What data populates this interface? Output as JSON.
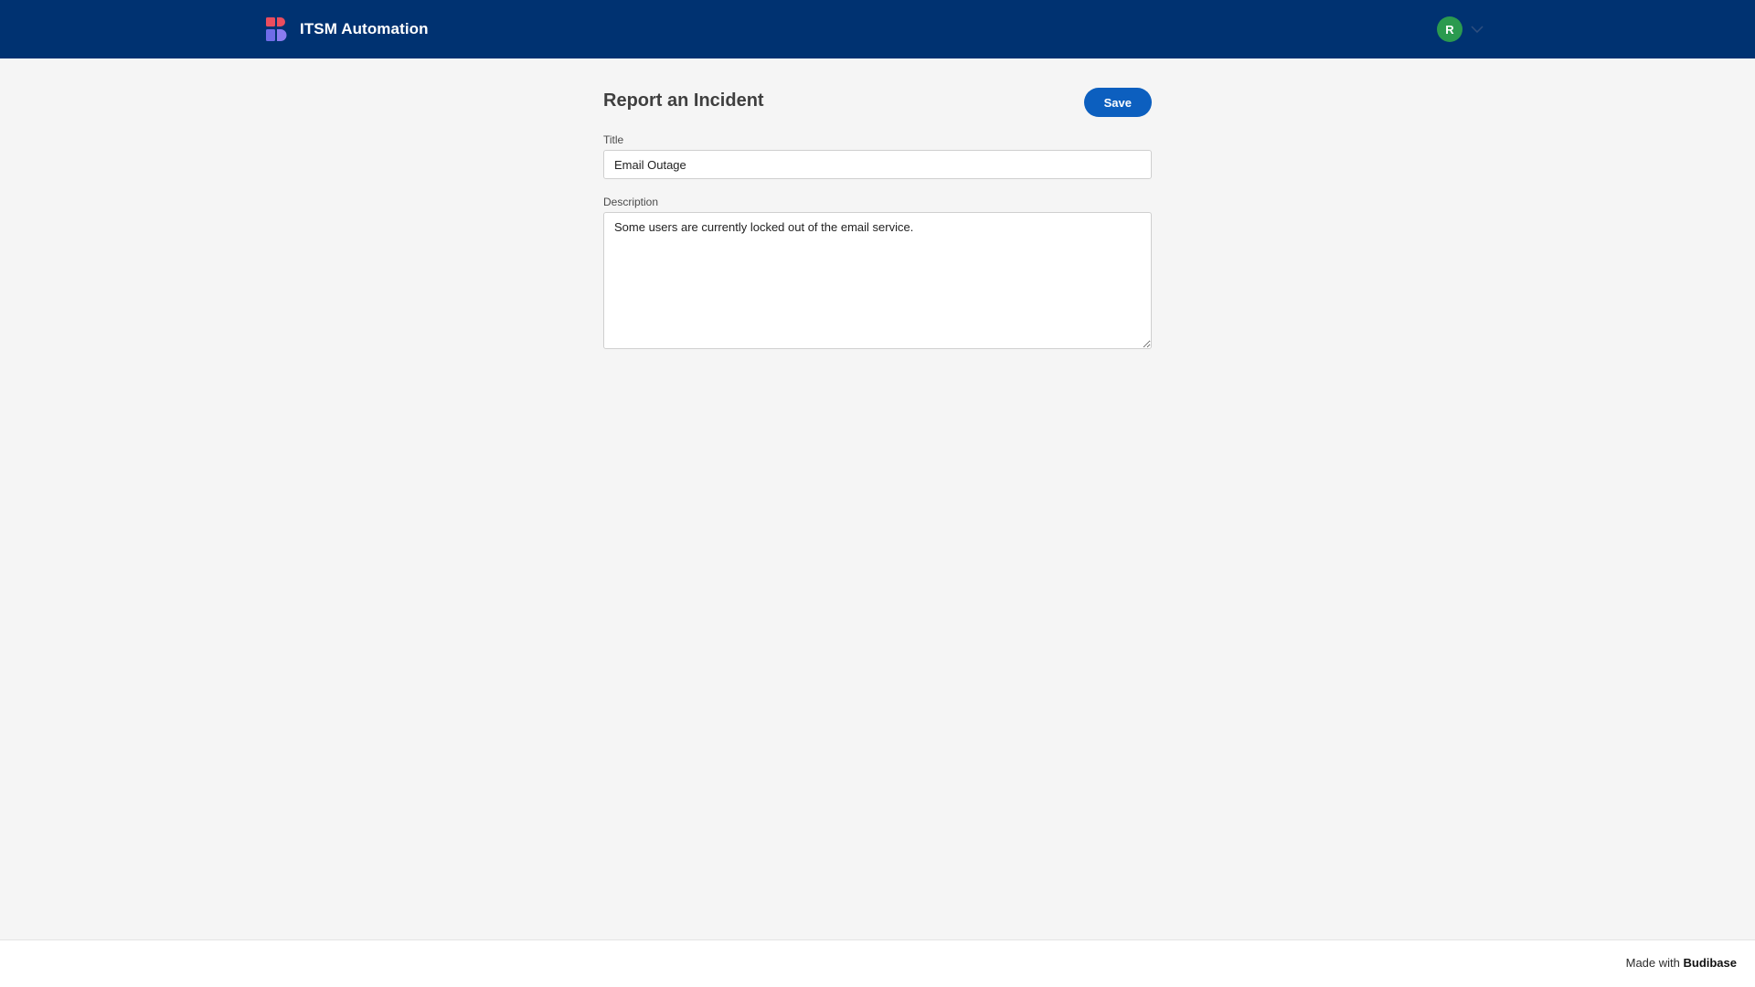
{
  "app": {
    "title": "ITSM Automation",
    "logo_icon": "budibase-logo-icon"
  },
  "user": {
    "avatar_initial": "R",
    "avatar_color": "#2b9a4f",
    "menu_icon": "chevron-down-icon"
  },
  "form": {
    "title": "Report an Incident",
    "save_label": "Save",
    "fields": {
      "title": {
        "label": "Title",
        "value": "Email Outage"
      },
      "description": {
        "label": "Description",
        "value": "Some users are currently locked out of the email service."
      }
    }
  },
  "footer": {
    "prefix": "Made with",
    "brand": "Budibase"
  },
  "colors": {
    "topbar": "#003271",
    "accent": "#0c5fbf",
    "background": "#f5f5f5"
  }
}
